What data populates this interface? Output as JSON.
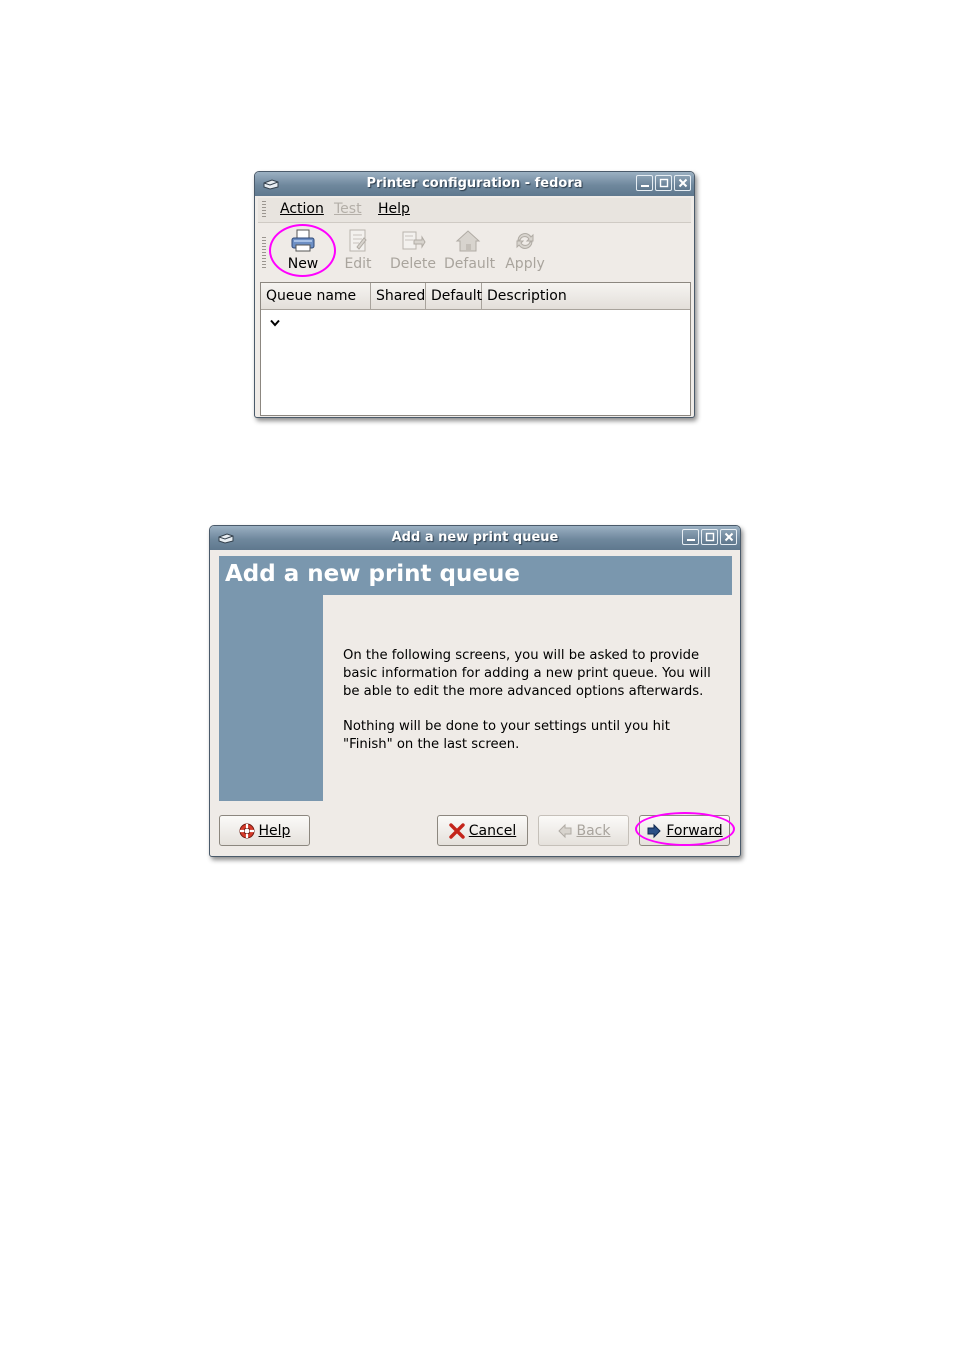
{
  "window1": {
    "title": "Printer configuration - fedora",
    "menu": [
      {
        "label": "Action",
        "enabled": true
      },
      {
        "label": "Test",
        "enabled": false
      },
      {
        "label": "Help",
        "enabled": true
      }
    ],
    "toolbar": [
      {
        "label": "New",
        "icon": "printer-icon",
        "enabled": true
      },
      {
        "label": "Edit",
        "icon": "edit-icon",
        "enabled": false
      },
      {
        "label": "Delete",
        "icon": "delete-icon",
        "enabled": false
      },
      {
        "label": "Default",
        "icon": "home-icon",
        "enabled": false
      },
      {
        "label": "Apply",
        "icon": "apply-icon",
        "enabled": false
      }
    ],
    "columns": [
      {
        "label": "Queue name",
        "sorted": true
      },
      {
        "label": "Shared"
      },
      {
        "label": "Default"
      },
      {
        "label": "Description"
      }
    ]
  },
  "window2": {
    "title": "Add a new print queue",
    "heading": "Add a new print queue",
    "paragraphs": [
      "On the following screens, you will be asked to provide basic information for adding a new print queue.  You will be able to edit the more advanced options afterwards.",
      "Nothing will be done to your settings until you hit \"Finish\" on the last screen."
    ],
    "buttons": {
      "help": {
        "label": "Help",
        "icon": "lifebuoy-icon"
      },
      "cancel": {
        "label": "Cancel",
        "icon": "x-icon"
      },
      "back": {
        "label": "Back",
        "icon": "back-arrow-icon",
        "enabled": false
      },
      "forward": {
        "label": "Forward",
        "icon": "forward-arrow-icon"
      }
    }
  },
  "colors": {
    "titlebar": "#6f889d",
    "banner": "#7a97ae",
    "window_bg": "#efebe7",
    "highlight_circle": "#ff00ff"
  }
}
